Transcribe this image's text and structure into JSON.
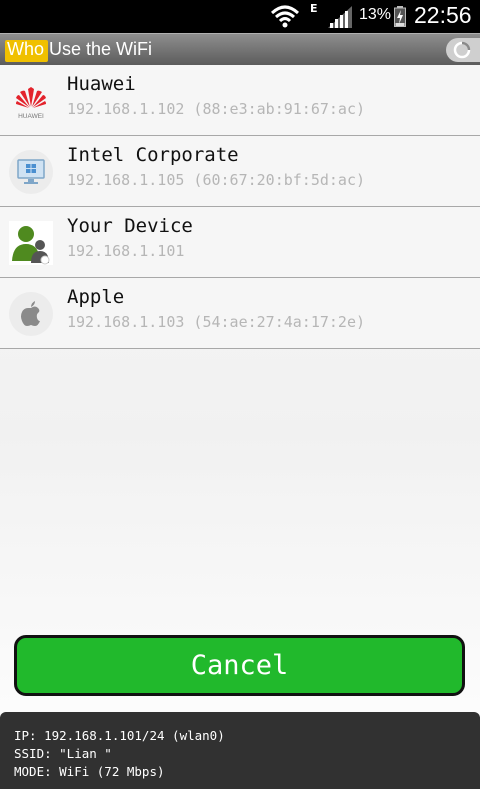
{
  "status_bar": {
    "network_type": "E",
    "battery": "13%",
    "time": "22:56"
  },
  "app": {
    "title": "Who Use the WiFi"
  },
  "devices": [
    {
      "name": "Huawei",
      "address": "192.168.1.102 (88:e3:ab:91:67:ac)",
      "icon": "huawei-logo-icon",
      "logo_text": "HUAWEI"
    },
    {
      "name": "Intel Corporate",
      "address": "192.168.1.105 (60:67:20:bf:5d:ac)",
      "icon": "windows-computer-icon"
    },
    {
      "name": "Your Device",
      "address": "192.168.1.101",
      "icon": "user-device-icon"
    },
    {
      "name": "Apple",
      "address": "192.168.1.103 (54:ae:27:4a:17:2e)",
      "icon": "apple-logo-icon"
    }
  ],
  "cancel_label": "Cancel",
  "info": {
    "ip": "IP: 192.168.1.101/24 (wlan0)",
    "ssid": "SSID: \"Lian \"",
    "mode": "MODE: WiFi (72 Mbps)"
  },
  "colors": {
    "accent_green": "#21b92c",
    "title_logo_yellow": "#f0c000",
    "huawei_red": "#e3232c"
  }
}
